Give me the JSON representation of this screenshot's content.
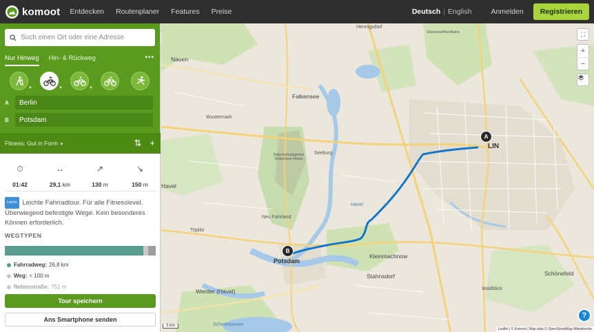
{
  "header": {
    "brand": "komoot",
    "nav": [
      "Entdecken",
      "Routenplaner",
      "Features",
      "Preise"
    ],
    "lang_active": "Deutsch",
    "lang_other": "English",
    "login": "Anmelden",
    "register": "Registrieren"
  },
  "planner": {
    "search_placeholder": "Such einen Ort oder eine Adresse",
    "tab_oneway": "Nur Hinweg",
    "tab_roundtrip": "Hin- & Rückweg",
    "sports": [
      "hiking-icon",
      "road-bike-icon",
      "mountain-bike-icon",
      "touring-bike-icon",
      "running-icon"
    ],
    "waypoint_a_letter": "A",
    "waypoint_a": "Berlin",
    "waypoint_b_letter": "B",
    "waypoint_b": "Potsdam",
    "fitness": "Fitness: Gut in Form"
  },
  "stats": {
    "duration": "01:42",
    "distance_value": "29,1",
    "distance_unit": "km",
    "ascent_value": "130",
    "ascent_unit": "m",
    "descent_value": "150",
    "descent_unit": "m"
  },
  "description": {
    "badge": "Leicht",
    "text": "Leichte Fahrradtour. Für alle Fitnesslevel. Überwiegend befestigte Wege. Kein besonderes Können erforderlich."
  },
  "wegtypen": {
    "title": "WEGTYPEN",
    "colors": [
      "#5a9e8f",
      "#c9c9c9",
      "#9e9e9e"
    ],
    "items": [
      {
        "label": "Fahrradweg:",
        "value": "26,8 km",
        "color": "#5a9e8f",
        "share": 0.92
      },
      {
        "label": "Weg:",
        "value": "< 100 m",
        "color": "#c9c9c9",
        "share": 0.03
      },
      {
        "label": "Nebenstraße:",
        "value": "751 m",
        "color": "#9e9e9e",
        "share": 0.05
      }
    ]
  },
  "actions": {
    "save": "Tour speichern",
    "phone": "Ans Smartphone senden"
  },
  "map": {
    "labels": {
      "hennigsdorf": "Hennigsdorf",
      "nauen": "Nauen",
      "falkensee": "Falkensee",
      "wustermark": "Wustermark",
      "seeburg": "Seeburg",
      "nsg": "Naturschutzgebiet Döberitzer Heide",
      "havel": "Havel",
      "neufahrland": "Neu Fahrland",
      "toplitz": "Töplitz",
      "potsdam": "Potsdam",
      "kleinmachnow": "Kleinmachnow",
      "stahnsdorf": "Stahnsdorf",
      "werder": "Werder (Havel)",
      "schoenefeld": "Schönefeld",
      "waldblick": "Waldblick",
      "berlin": "LIN",
      "schwielowsee": "Schwielowsee",
      "oranienburg": "Glienicke/Nordbahn"
    },
    "marker_a": "A",
    "marker_b": "B",
    "scale": "3 km",
    "attribution": "Leaflet | © Komoot | Map data © OpenStreetMap-Mitwirkende",
    "route_color": "#1476c8"
  }
}
